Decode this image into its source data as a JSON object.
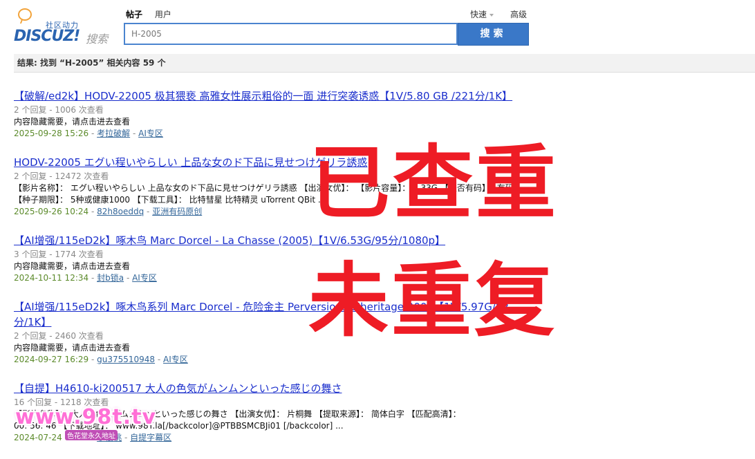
{
  "logo": {
    "tagline": "社区动力",
    "word": "DISCUZ!",
    "sub": "搜索"
  },
  "tabs": [
    {
      "label": "帖子",
      "active": true
    },
    {
      "label": "用户",
      "active": false
    }
  ],
  "search": {
    "value": "H-2005",
    "button": "搜索",
    "quick": "快速",
    "advanced": "高级"
  },
  "result_bar": "结果: 找到 “H-2005” 相关内容 59 个",
  "results": [
    {
      "title": "【破解/ed2k】HODV-22005 极其猥亵 高雅女性展示粗俗的一面 进行突袭诱惑【1V/5.80 GB /221分/1K】",
      "meta": "2 个回复 - 1006 次查看",
      "summary": "内容隐藏需要，请点击进去查看",
      "date": "2025-09-28 15:26",
      "author": "考拉破解",
      "forum": "AI专区"
    },
    {
      "title": "HODV-22005 エグい程いやらしい 上品な女のド下品に見せつけゲリラ誘惑",
      "meta": "2 个回复 - 12472 次查看",
      "summary": "【影片名称】： エグい程いやらしい 上品な女のド下品に見せつけゲリラ誘惑 【出演女优】： 【影片容量】： 9.33G 【是否有码】： 有码",
      "summary2": "【种子期限】： 5种或健康1000 【下载工具】： 比特彗星 比特精灵 uTorrent QBit ...",
      "date": "2025-09-26 10:24",
      "author": "82h8oeddq",
      "forum": "亚洲有码原创"
    },
    {
      "title": "【AI增强/115eD2k】啄木鸟 Marc Dorcel - La Chasse (2005)【1V/6.53G/95分/1080p】",
      "meta": "3 个回复 - 1774 次查看",
      "summary": "内容隐藏需要，请点击进去查看",
      "date": "2024-10-11 12:34",
      "author": "封b锁a",
      "forum": "AI专区"
    },
    {
      "title": "【AI增强/115eD2k】啄木鸟系列 Marc Dorcel - 危险金主 Perversions d'heritage 2005【1V/5.97G/82分/1K】",
      "meta": "2 个回复 - 2460 次查看",
      "summary": "内容隐藏需要，请点击进去查看",
      "date": "2024-09-27 16:29",
      "author": "gu375510948",
      "forum": "AI专区"
    },
    {
      "title": "【自提】H4610-ki200517 大人の色気がムンムンといった感じの舞さ",
      "meta": "16 个回复 - 1218 次查看",
      "summary": "【影片名称】： 大人の色気がムンムンといった感じの舞さ 【出演女优】： 片桐舞 【提取来源】： 简体白字 【匹配高清】：",
      "summary2": "00: 56: 46 【下载地址】： www.98T.la[/backcolor]@PTBBSMCBJi01 [/backcolor] ...",
      "date": "2024-07-24 07:45",
      "author": "小樱桃",
      "forum": "自提字幕区"
    }
  ],
  "stamps": [
    "已查重",
    "未重复"
  ],
  "watermark": {
    "url": "www.98t.tv",
    "sub": "色花堂永久地址"
  }
}
